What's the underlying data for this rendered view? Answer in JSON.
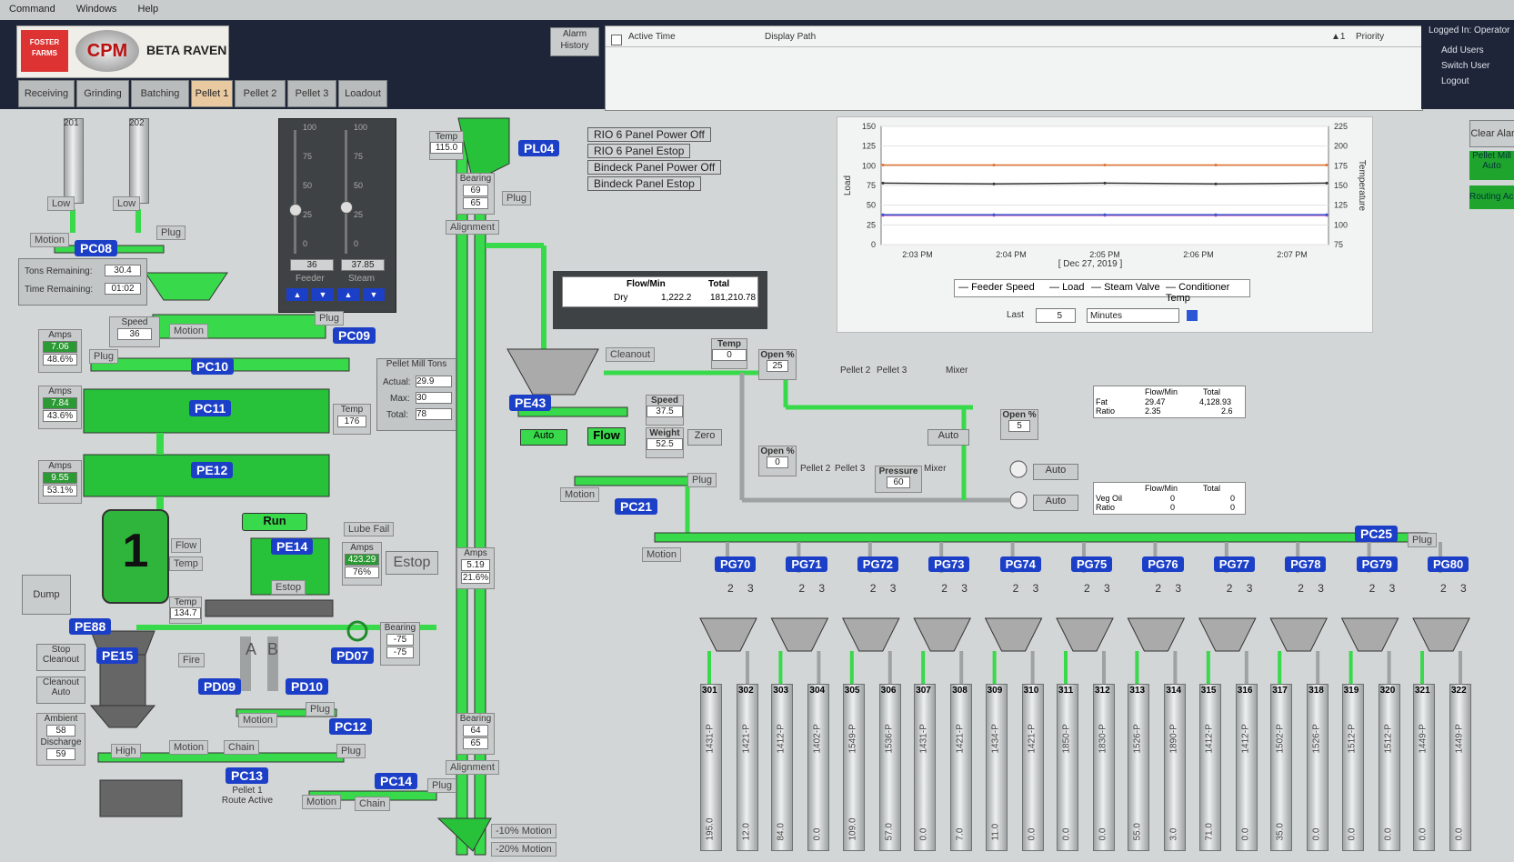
{
  "menu": [
    "Command",
    "Windows",
    "Help"
  ],
  "logo": {
    "brand1": "FOSTER FARMS",
    "brand2": "CPM",
    "product": "BETA RAVEN"
  },
  "tabs": [
    {
      "label": "Receiving",
      "active": false
    },
    {
      "label": "Grinding",
      "active": false
    },
    {
      "label": "Batching",
      "active": false
    },
    {
      "label": "Pellet 1",
      "active": true
    },
    {
      "label": "Pellet 2",
      "active": false
    },
    {
      "label": "Pellet 3",
      "active": false
    },
    {
      "label": "Loadout",
      "active": false
    }
  ],
  "alarm": {
    "history_label": "Alarm History",
    "col_active_time": "Active Time",
    "col_display_path": "Display Path",
    "sort_indicator": "▲1",
    "col_priority": "Priority"
  },
  "user_panel": {
    "logged_in": "Logged In: Operator",
    "add_users": "Add Users",
    "switch_user": "Switch User",
    "logout": "Logout"
  },
  "right_buttons": {
    "clear_alarms": "Clear Alar",
    "pellet_mill_auto": "Pellet Mill Auto",
    "routing": "Routing Ac"
  },
  "bins": [
    {
      "id": "201",
      "level_label": "Low"
    },
    {
      "id": "202",
      "level_label": "Low"
    }
  ],
  "pc08": {
    "tag": "PC08",
    "motion": "Motion",
    "plug": "Plug"
  },
  "remaining": {
    "tons_label": "Tons Remaining:",
    "tons": "30.4",
    "time_label": "Time Remaining:",
    "time": "01:02"
  },
  "sliders": {
    "scale": [
      "100",
      "75",
      "50",
      "25",
      "0"
    ],
    "feeder_value": "36",
    "feeder_label": "Feeder",
    "steam_value": "37.85",
    "steam_label": "Steam",
    "feeder_level": 0.36,
    "steam_level": 0.38
  },
  "pc09": {
    "tag": "PC09",
    "speed_label": "Speed",
    "speed": "36",
    "motion": "Motion",
    "plug": "Plug"
  },
  "pc10": {
    "tag": "PC10",
    "amps_label": "Amps",
    "amps": "7.06",
    "pct": "48.6%",
    "plug": "Plug"
  },
  "pc11": {
    "tag": "PC11",
    "amps_label": "Amps",
    "amps": "7.84",
    "pct": "43.6%",
    "temp_label": "Temp",
    "temp": "176"
  },
  "pe12": {
    "tag": "PE12",
    "amps_label": "Amps",
    "amps": "9.55",
    "pct": "53.1%"
  },
  "pellet_mill": {
    "number": "1",
    "run": "Run",
    "flow": "Flow",
    "temp_label": "Temp",
    "temp": "134.7",
    "lube_fail": "Lube Fail",
    "amps_label": "Amps",
    "amps": "423.29",
    "pct": "76%",
    "estop": "Estop",
    "estop_small": "Estop",
    "dump": "Dump",
    "fire": "Fire",
    "stop_cleanout": "Stop Cleanout",
    "cleanout_auto": "Cleanout Auto",
    "ambient_label": "Ambient",
    "ambient": "58",
    "discharge_label": "Discharge",
    "discharge": "59"
  },
  "tags": {
    "pe14": "PE14",
    "pe88": "PE88",
    "pe15": "PE15",
    "pd07": "PD07",
    "pd09": "PD09",
    "pd10": "PD10",
    "pc12": "PC12",
    "pc13": "PC13",
    "pc14": "PC14",
    "pl04": "PL04",
    "pe43": "PE43",
    "pc21": "PC21",
    "pc25": "PC25"
  },
  "pd07_bearing": {
    "label": "Bearing",
    "v1": "-75",
    "v2": "-75"
  },
  "pc12_labels": {
    "motion": "Motion",
    "plug": "Plug",
    "a": "A",
    "b": "B"
  },
  "pc13_labels": {
    "high": "High",
    "motion": "Motion",
    "chain": "Chain",
    "plug": "Plug",
    "route": "Pellet 1 Route Active"
  },
  "pc14_labels": {
    "motion": "Motion",
    "chain": "Chain",
    "plug": "Plug"
  },
  "pellet_tons": {
    "title": "Pellet Mill Tons",
    "actual_label": "Actual:",
    "actual": "29.9",
    "max_label": "Max:",
    "max": "30",
    "total_label": "Total:",
    "total": "78"
  },
  "elevator": {
    "temp_label": "Temp",
    "temp": "115.0",
    "bearing_label": "Bearing",
    "top_b1": "69",
    "top_b2": "65",
    "plug": "Plug",
    "alignment": "Alignment",
    "amps_label": "Amps",
    "amps": "5.19",
    "pct": "21.6%",
    "bot_b1": "64",
    "bot_b2": "65",
    "alignment2": "Alignment",
    "motion10": "-10% Motion",
    "motion20": "-20% Motion"
  },
  "panel_messages": [
    "RIO 6 Panel Power Off",
    "RIO 6 Panel Estop",
    "Bindeck Panel Power Off",
    "Bindeck Panel Estop"
  ],
  "flow_table": {
    "col1": "Flow/Min",
    "col2": "Total",
    "row_label": "Dry",
    "flow": "1,222.2",
    "total": "181,210.78"
  },
  "pe43": {
    "cleanout": "Cleanout",
    "auto": "Auto",
    "flow": "Flow",
    "speed_label": "Speed",
    "speed": "37.5",
    "weight_label": "Weight",
    "weight": "52.5",
    "zero": "Zero",
    "temp_label": "Temp",
    "temp": "0"
  },
  "fat_line": {
    "open_label": "Open %",
    "open1": "25",
    "pellet2": "Pellet 2",
    "pellet3": "Pellet 3",
    "mixer": "Mixer",
    "open2_label": "Open %",
    "open2": "5",
    "auto": "Auto"
  },
  "oil_line": {
    "open_label": "Open %",
    "open": "0",
    "pellet2": "Pellet 2",
    "pellet3": "Pellet 3",
    "pressure_label": "Pressure",
    "pressure": "60",
    "mixer": "Mixer",
    "auto1": "Auto",
    "auto2": "Auto"
  },
  "fat_table": {
    "col1": "Flow/Min",
    "col2": "Total",
    "r1_label": "Fat",
    "r1_flow": "29.47",
    "r1_total": "4,128.93",
    "r2_label": "Ratio",
    "r2_flow": "2.35",
    "r2_total": "2.6"
  },
  "oil_table": {
    "col1": "Flow/Min",
    "col2": "Total",
    "r1_label": "Veg Oil",
    "r1_flow": "0",
    "r1_total": "0",
    "r2_label": "Ratio",
    "r2_flow": "0",
    "r2_total": "0"
  },
  "pc21_labels": {
    "motion": "Motion",
    "plug": "Plug"
  },
  "pc25_labels": {
    "motion": "Motion",
    "plug": "Plug"
  },
  "trend": {
    "y_left_ticks": [
      "150",
      "125",
      "100",
      "75",
      "50",
      "25",
      "0"
    ],
    "y_right_ticks": [
      "225",
      "200",
      "175",
      "150",
      "125",
      "100",
      "75"
    ],
    "y_left_label": "Load",
    "y_right_label": "Temperature",
    "x_ticks": [
      "2:03 PM",
      "2:04 PM",
      "2:05 PM",
      "2:06 PM",
      "2:07 PM"
    ],
    "date": "[ Dec 27, 2019 ]",
    "legend": [
      "Feeder Speed",
      "Load",
      "Steam Valve",
      "Conditioner Temp"
    ],
    "last_label": "Last",
    "last_value": "5",
    "units": "Minutes"
  },
  "chart_data": {
    "type": "line",
    "x": [
      "2:03 PM",
      "2:04 PM",
      "2:05 PM",
      "2:06 PM",
      "2:07 PM"
    ],
    "ylim": [
      0,
      150
    ],
    "ylabel": "Load",
    "ylabel_right": "Temperature",
    "ylim_right": [
      75,
      225
    ],
    "series": [
      {
        "name": "Feeder Speed",
        "values": [
          37,
          37,
          37,
          37,
          37
        ],
        "color": "#c050c0"
      },
      {
        "name": "Load",
        "values": [
          78,
          77,
          78,
          77,
          78
        ],
        "color": "#333333"
      },
      {
        "name": "Steam Valve",
        "values": [
          38,
          38,
          38,
          38,
          38
        ],
        "color": "#3a55c8"
      },
      {
        "name": "Conditioner Temp",
        "values": [
          176,
          176,
          176,
          176,
          176
        ],
        "color": "#e07030",
        "axis": "right"
      }
    ]
  },
  "pellet_bins": [
    {
      "tag": "PG70",
      "left": {
        "num": "301",
        "value": "1431-P",
        "reading": "195.0"
      },
      "right": {
        "num": "302",
        "value": "1421-P",
        "reading": "12.0"
      }
    },
    {
      "tag": "PG71",
      "left": {
        "num": "303",
        "value": "1412-P",
        "reading": "84.0"
      },
      "right": {
        "num": "304",
        "value": "1402-P",
        "reading": "0.0"
      }
    },
    {
      "tag": "PG72",
      "left": {
        "num": "305",
        "value": "1549-P",
        "reading": "109.0"
      },
      "right": {
        "num": "306",
        "value": "1536-P",
        "reading": "57.0"
      }
    },
    {
      "tag": "PG73",
      "left": {
        "num": "307",
        "value": "1431-P",
        "reading": "0.0"
      },
      "right": {
        "num": "308",
        "value": "1421-P",
        "reading": "7.0"
      }
    },
    {
      "tag": "PG74",
      "left": {
        "num": "309",
        "value": "1434-P",
        "reading": "11.0"
      },
      "right": {
        "num": "310",
        "value": "1421-P",
        "reading": "0.0"
      }
    },
    {
      "tag": "PG75",
      "left": {
        "num": "311",
        "value": "1850-P",
        "reading": "0.0"
      },
      "right": {
        "num": "312",
        "value": "1830-P",
        "reading": "0.0"
      }
    },
    {
      "tag": "PG76",
      "left": {
        "num": "313",
        "value": "1526-P",
        "reading": "55.0"
      },
      "right": {
        "num": "314",
        "value": "1890-P",
        "reading": "3.0"
      }
    },
    {
      "tag": "PG77",
      "left": {
        "num": "315",
        "value": "1412-P",
        "reading": "71.0"
      },
      "right": {
        "num": "316",
        "value": "1412-P",
        "reading": "0.0"
      }
    },
    {
      "tag": "PG78",
      "left": {
        "num": "317",
        "value": "1502-P",
        "reading": "35.0"
      },
      "right": {
        "num": "318",
        "value": "1526-P",
        "reading": "0.0"
      }
    },
    {
      "tag": "PG79",
      "left": {
        "num": "319",
        "value": "1512-P",
        "reading": "0.0"
      },
      "right": {
        "num": "320",
        "value": "1512-P",
        "reading": "0.0"
      }
    },
    {
      "tag": "PG80",
      "left": {
        "num": "321",
        "value": "1449-P",
        "reading": "0.0"
      },
      "right": {
        "num": "322",
        "value": "1449-P",
        "reading": "0.0"
      }
    }
  ],
  "gate_labels": {
    "two": "2",
    "three": "3"
  }
}
